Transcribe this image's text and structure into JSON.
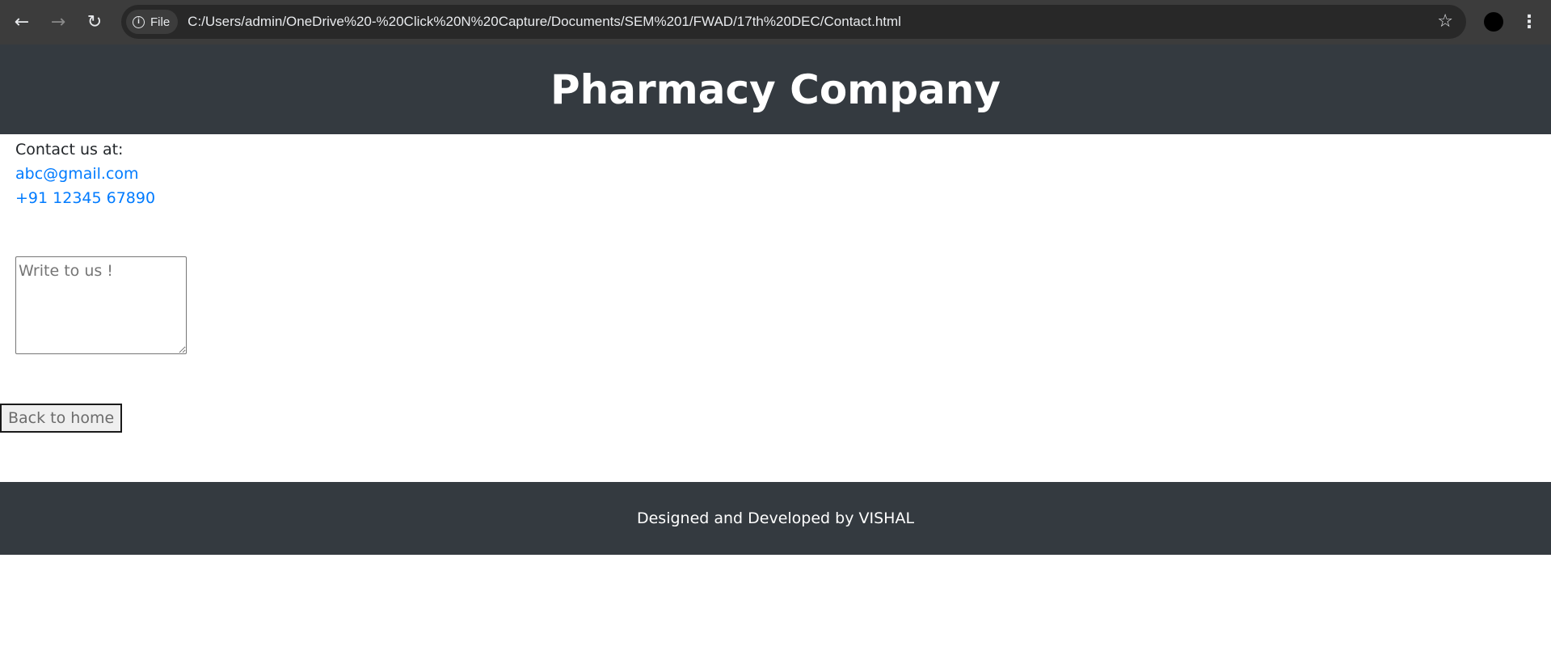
{
  "browser": {
    "url": "C:/Users/admin/OneDrive%20-%20Click%20N%20Capture/Documents/SEM%201/FWAD/17th%20DEC/Contact.html",
    "site_chip_label": "File",
    "icons": {
      "back": "arrow-left-icon",
      "forward": "arrow-right-icon",
      "reload": "reload-icon",
      "info": "info-icon",
      "bookmark": "star-icon",
      "profile": "profile-avatar-icon",
      "menu": "kebab-menu-icon"
    }
  },
  "header": {
    "title": "Pharmacy Company"
  },
  "contact": {
    "label": "Contact us at:",
    "email": "abc@gmail.com",
    "phone": "+91 12345 67890"
  },
  "message": {
    "placeholder": "Write to us !",
    "value": ""
  },
  "back_button": {
    "label": "Back to home"
  },
  "footer": {
    "text": "Designed and Developed by VISHAL"
  },
  "colors": {
    "header_bg": "#343a40",
    "footer_bg": "#343a40",
    "link": "#007bff",
    "browser_chrome": "#3c3c3c"
  }
}
